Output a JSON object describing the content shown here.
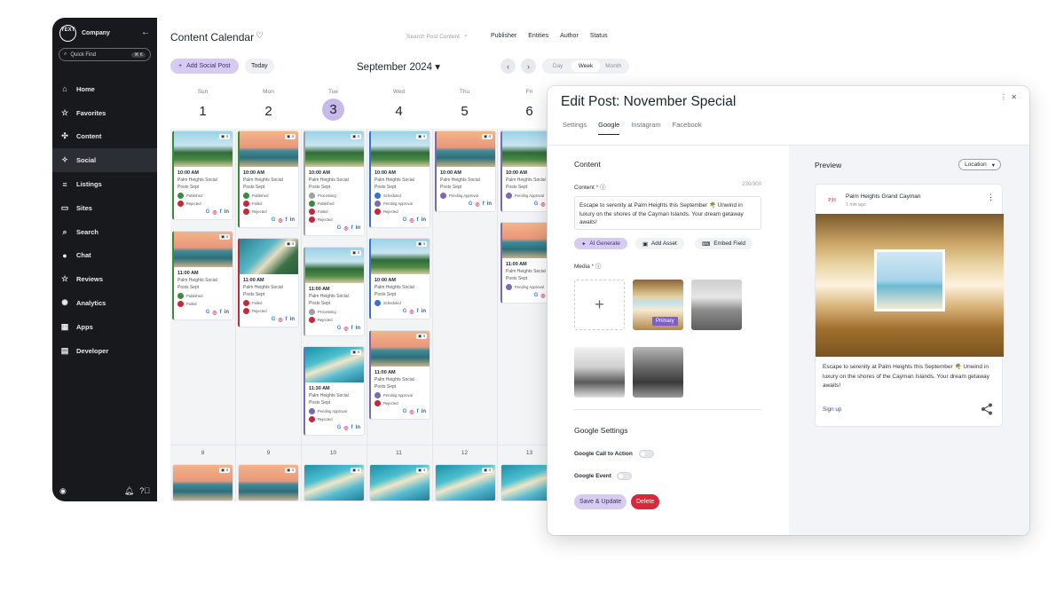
{
  "sidebar": {
    "logo_text": "YEXT",
    "company": "Company",
    "quick_find": "Quick Find",
    "quick_find_kbd": "⌘ K",
    "items": [
      {
        "label": "Home",
        "icon": "home-icon"
      },
      {
        "label": "Favorites",
        "icon": "star-icon"
      },
      {
        "label": "Content",
        "icon": "content-icon"
      },
      {
        "label": "Social",
        "icon": "social-icon"
      },
      {
        "label": "Listings",
        "icon": "listings-icon"
      },
      {
        "label": "Sites",
        "icon": "sites-icon"
      },
      {
        "label": "Search",
        "icon": "search-icon"
      },
      {
        "label": "Chat",
        "icon": "chat-icon"
      },
      {
        "label": "Reviews",
        "icon": "reviews-icon"
      },
      {
        "label": "Analytics",
        "icon": "analytics-icon"
      },
      {
        "label": "Apps",
        "icon": "apps-icon"
      },
      {
        "label": "Developer",
        "icon": "developer-icon"
      }
    ],
    "active_item": "Social"
  },
  "header": {
    "title": "Content Calendar",
    "search_placeholder": "Search Post Content",
    "filters": [
      "Publisher",
      "Entities",
      "Author",
      "Status"
    ]
  },
  "toolbar": {
    "add_label": "Add Social Post",
    "today_label": "Today",
    "month": "September 2024",
    "views": [
      "Day",
      "Week",
      "Month"
    ],
    "selected_view": "Week"
  },
  "days": [
    {
      "name": "Sun",
      "date": "1"
    },
    {
      "name": "Mon",
      "date": "2"
    },
    {
      "name": "Tue",
      "date": "3"
    },
    {
      "name": "Wed",
      "date": "4"
    },
    {
      "name": "Thu",
      "date": "5"
    },
    {
      "name": "Fri",
      "date": "6"
    }
  ],
  "week2_dates": [
    "8",
    "9",
    "10",
    "11",
    "12",
    "13"
  ],
  "post_title": "Palm Heights Social Posts Sept",
  "modal": {
    "title": "Edit Post: November Special",
    "tabs": [
      "Settings",
      "Google",
      "Instagram",
      "Facebook"
    ],
    "selected_tab": "Google",
    "content_heading": "Content",
    "content_label": "Content",
    "counter": "230/300",
    "content_text": "Escape to serenity at Palm Heights this September 🌴 Unwind in luxury on the shores of the Cayman Islands. Your dream getaway awaits!",
    "ai_generate": "AI Generate",
    "add_asset": "Add Asset",
    "embed_field": "Embed Field",
    "media_label": "Media",
    "primary_badge": "Primary",
    "google_settings": "Google Settings",
    "cta_label": "Google Call to Action",
    "event_label": "Google Event",
    "save_label": "Save & Update",
    "delete_label": "Delete",
    "preview_heading": "Preview",
    "location_select": "Location",
    "preview_name": "Palm Heights Grand Cayman",
    "preview_time": "1 min ago",
    "preview_avatar": "P|H",
    "preview_text": "Escape to serenity at Palm Heights this September 🌴 Unwind in luxury on the shores of the Cayman Islands. Your dream getaway awaits!",
    "preview_cta": "Sign up"
  },
  "colors": {
    "accent": "#c8b9ec",
    "delete": "#d9283c",
    "sidebar": "#17191d"
  }
}
